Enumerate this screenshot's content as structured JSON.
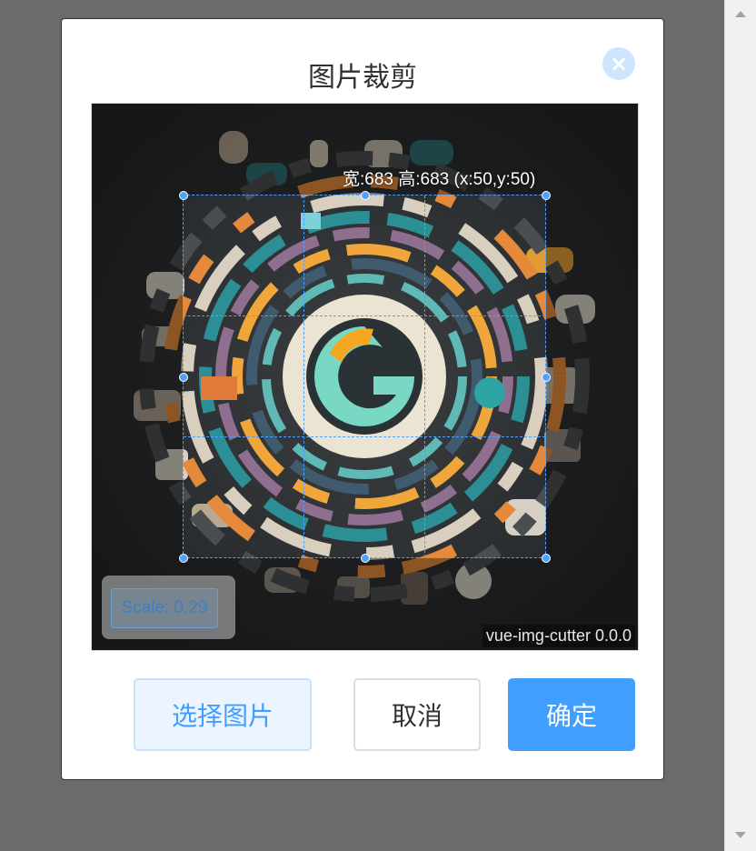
{
  "dialog": {
    "title": "图片裁剪",
    "close_icon": "×"
  },
  "cutter": {
    "size_info": "宽:683 高:683 (x:50,y:50)",
    "scale_label": "Scale: 0.29",
    "version_label": "vue-img-cutter 0.0.0",
    "image_description": "circular colorful G logo artwork surrounded by app icons on dark background",
    "accent_color": "#4da2ff"
  },
  "buttons": {
    "select_image": "选择图片",
    "cancel": "取消",
    "confirm": "确定"
  },
  "colors": {
    "primary": "#409eff",
    "overlay": "#6b6b6b"
  }
}
